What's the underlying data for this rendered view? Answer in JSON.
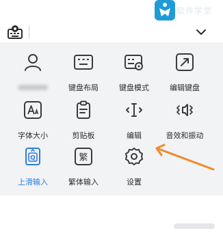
{
  "watermark": {
    "text": "软件学堂"
  },
  "toolbar": {
    "keyboard_icon": "keyboard-settings-icon",
    "collapse_icon": "chevron-down-icon"
  },
  "panel": {
    "items": [
      {
        "label": "",
        "icon": "user-icon"
      },
      {
        "label": "键盘布局",
        "icon": "keyboard-layout-icon"
      },
      {
        "label": "键盘模式",
        "icon": "keyboard-mode-icon"
      },
      {
        "label": "编辑键盘",
        "icon": "edit-keyboard-icon"
      },
      {
        "label": "字体大小",
        "icon": "font-size-icon"
      },
      {
        "label": "剪贴板",
        "icon": "clipboard-icon"
      },
      {
        "label": "编辑",
        "icon": "text-cursor-icon"
      },
      {
        "label": "音效和振动",
        "icon": "sound-vibration-icon"
      },
      {
        "label": "上滑输入",
        "icon": "swipe-up-input-icon"
      },
      {
        "label": "繁体输入",
        "icon": "traditional-input-icon",
        "glyph": "繁"
      },
      {
        "label": "设置",
        "icon": "settings-gear-icon"
      }
    ]
  },
  "colors": {
    "panel_bg": "#f2f3f5",
    "icon_stroke": "#3a3a3a",
    "active_blue": "#2a7de1",
    "arrow_orange": "#f08a2a"
  }
}
